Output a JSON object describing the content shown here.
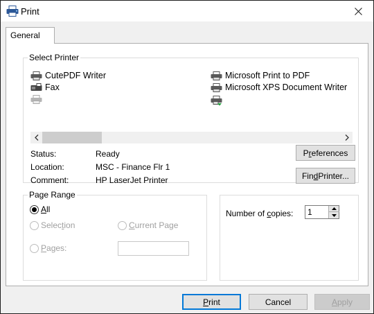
{
  "window": {
    "title": "Print"
  },
  "tabs": [
    {
      "label": "General"
    }
  ],
  "select_printer": {
    "legend": "Select Printer",
    "printers": [
      {
        "name": "CutePDF Writer",
        "icon": "printer-icon"
      },
      {
        "name": "Fax",
        "icon": "fax-icon"
      },
      {
        "name": "",
        "icon": "printer-icon"
      },
      {
        "name": "Microsoft Print to PDF",
        "icon": "printer-icon"
      },
      {
        "name": "Microsoft XPS Document Writer",
        "icon": "printer-icon"
      },
      {
        "name": "",
        "icon": "add-printer-icon"
      }
    ],
    "status_label": "Status:",
    "status_value": "Ready",
    "location_label": "Location:",
    "location_value": "MSC - Finance Flr 1",
    "comment_label": "Comment:",
    "comment_value": "HP LaserJet Printer",
    "preferences_button": {
      "pre": "P",
      "key": "r",
      "post": "eferences"
    },
    "find_printer_button": {
      "pre": "Fin",
      "key": "d",
      "post": " Printer..."
    }
  },
  "page_range": {
    "legend": "Page Range",
    "all": {
      "key": "A",
      "post": "ll"
    },
    "selection": {
      "pre": "Selec",
      "key": "t",
      "post": "ion"
    },
    "current_page": {
      "key": "C",
      "post": "urrent Page"
    },
    "pages": {
      "key": "P",
      "post": "ages:"
    },
    "pages_value": "",
    "selected": "all"
  },
  "copies": {
    "label": {
      "pre": "Number of ",
      "key": "c",
      "post": "opies:"
    },
    "value": "1"
  },
  "footer": {
    "print": {
      "key": "P",
      "post": "rint"
    },
    "cancel": "Cancel",
    "apply": {
      "key": "A",
      "post": "pply"
    }
  },
  "colors": {
    "accent": "#0078d7",
    "panel_bg": "#ffffff",
    "window_bg": "#f0f0f0"
  }
}
